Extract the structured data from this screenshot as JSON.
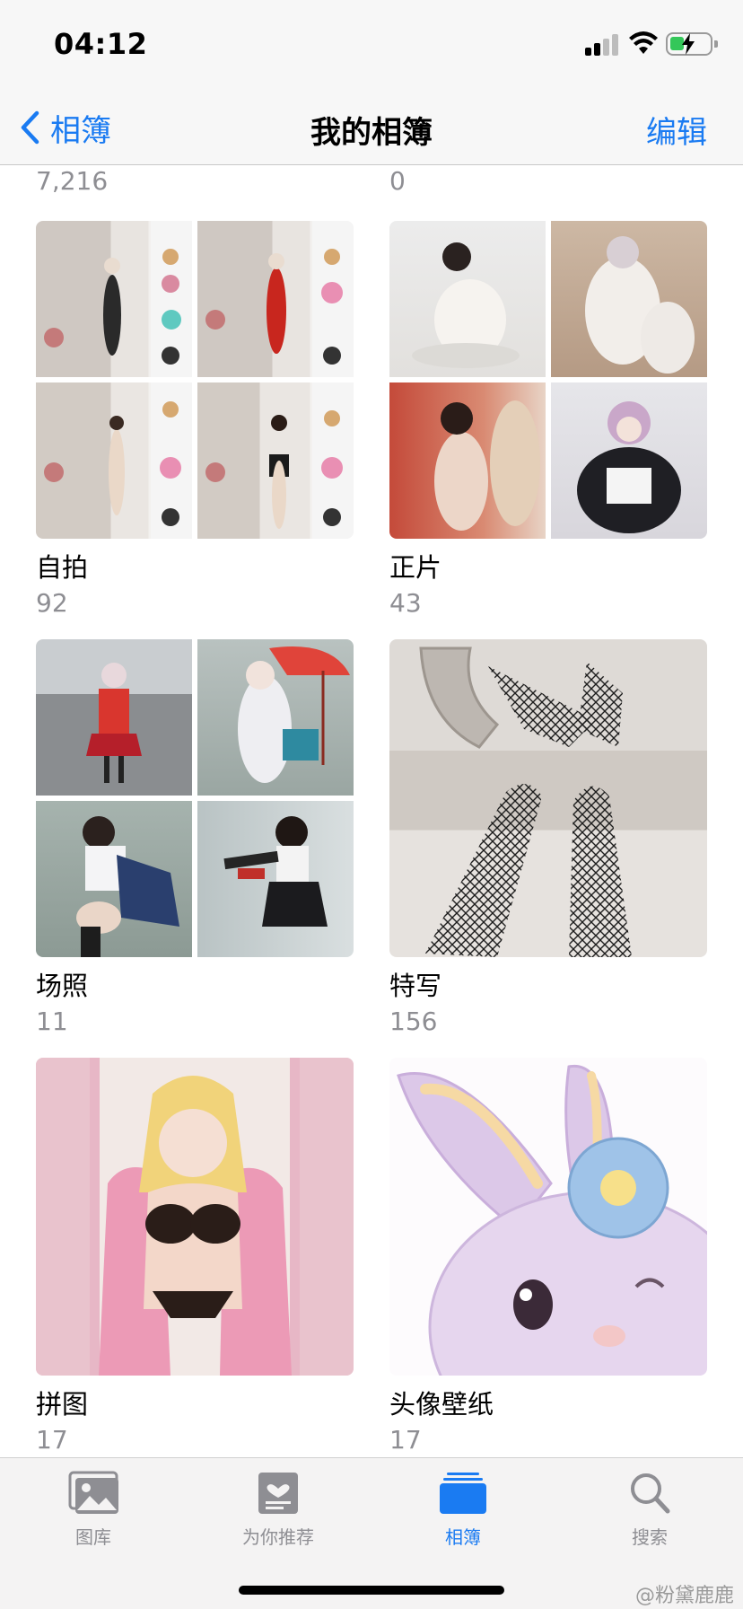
{
  "status_bar": {
    "time": "04:12",
    "battery_charging": true
  },
  "nav": {
    "back_label": "相簿",
    "title": "我的相簿",
    "edit_label": "编辑"
  },
  "partial_row": {
    "left_count": "7,216",
    "right_count": "0"
  },
  "albums": [
    {
      "name": "自拍",
      "count": "92"
    },
    {
      "name": "正片",
      "count": "43"
    },
    {
      "name": "场照",
      "count": "11"
    },
    {
      "name": "特写",
      "count": "156"
    },
    {
      "name": "拼图",
      "count": "17"
    },
    {
      "name": "头像壁纸",
      "count": "17"
    }
  ],
  "tabs": [
    {
      "label": "图库",
      "icon": "photo-library-icon",
      "active": false
    },
    {
      "label": "为你推荐",
      "icon": "for-you-icon",
      "active": false
    },
    {
      "label": "相簿",
      "icon": "albums-icon",
      "active": true
    },
    {
      "label": "搜索",
      "icon": "search-icon",
      "active": false
    }
  ],
  "watermark": "@粉黛鹿鹿",
  "colors": {
    "accent": "#1a7bf2",
    "secondary_text": "#8e8e93",
    "battery": "#34c759"
  }
}
